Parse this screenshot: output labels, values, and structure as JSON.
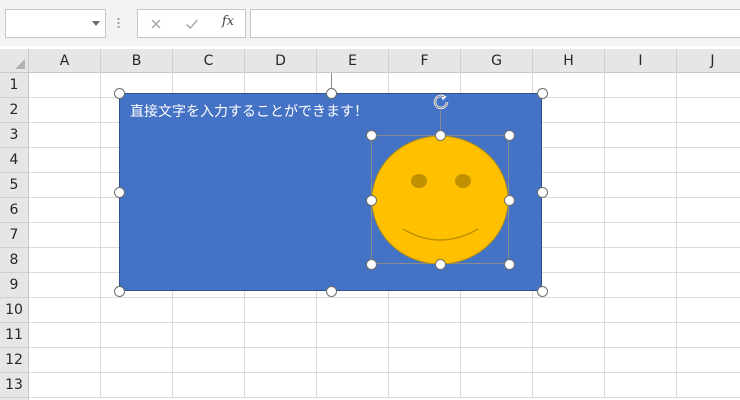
{
  "formula_bar": {
    "name_box_value": "",
    "formula_value": "",
    "cancel_icon": "x-icon",
    "enter_icon": "check-icon",
    "function_icon": "fx-icon",
    "function_label": "fx"
  },
  "sheet": {
    "columns": [
      "A",
      "B",
      "C",
      "D",
      "E",
      "F",
      "G",
      "H",
      "I",
      "J"
    ],
    "rows": [
      "1",
      "2",
      "3",
      "4",
      "5",
      "6",
      "7",
      "8",
      "9",
      "10",
      "11",
      "12",
      "13"
    ]
  },
  "shapes": {
    "rectangle": {
      "text": "直接文字を入力することができます！",
      "fill_color": "#4472c4",
      "text_color": "#ffffff"
    },
    "smiley": {
      "fill_color": "#ffc000",
      "outline_color": "#b8900a",
      "feature_color": "#bf9000"
    }
  },
  "colors": {
    "selection_handle": "#ffffff",
    "handle_border": "#6f6f6f",
    "grid_line": "#dcdcdc",
    "header_bg": "#e6e6e6"
  }
}
